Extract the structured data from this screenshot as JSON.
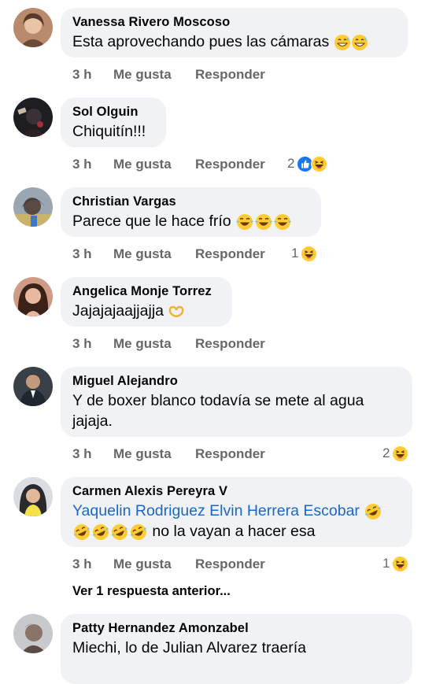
{
  "comments": [
    {
      "name": "Vanessa Rivero Moscoso",
      "text": "Esta aprovechando pues las cámaras",
      "time": "3 h",
      "like": "Me gusta",
      "reply": "Responder",
      "reaction_count": "",
      "reactions": []
    },
    {
      "name": "Sol Olguin",
      "text": "Chiquitín!!!",
      "time": "3 h",
      "like": "Me gusta",
      "reply": "Responder",
      "reaction_count": "2",
      "reactions": [
        "like-icon",
        "haha-icon"
      ]
    },
    {
      "name": "Christian Vargas",
      "text": "Parece que le hace frío",
      "time": "3 h",
      "like": "Me gusta",
      "reply": "Responder",
      "reaction_count": "1",
      "reactions": [
        "haha-icon"
      ]
    },
    {
      "name": "Angelica Monje Torrez",
      "text": "Jajajajaajjajja",
      "time": "3 h",
      "like": "Me gusta",
      "reply": "Responder",
      "reaction_count": "",
      "reactions": []
    },
    {
      "name": "Miguel Alejandro",
      "text": "Y de boxer blanco todavía se mete al agua jajaja.",
      "time": "3 h",
      "like": "Me gusta",
      "reply": "Responder",
      "reaction_count": "2",
      "reactions": [
        "haha-icon"
      ]
    },
    {
      "name": "Carmen Alexis Pereyra V",
      "mention": "Yaquelin Rodriguez Elvin Herrera Escobar",
      "text": "no la vayan a hacer esa",
      "time": "3 h",
      "like": "Me gusta",
      "reply": "Responder",
      "reaction_count": "1",
      "reactions": [
        "haha-icon"
      ]
    },
    {
      "name": "Patty Hernandez Amonzabel",
      "text": "Miechi, lo de Julian Alvarez traería"
    }
  ],
  "view_previous_reply": "Ver 1 respuesta anterior...",
  "colors": {
    "bubble": "#f0f2f5",
    "meta": "#65676b",
    "mention": "#1b67c9",
    "like_blue": "#1877f2",
    "emoji_yellow": "#ffcc33"
  }
}
